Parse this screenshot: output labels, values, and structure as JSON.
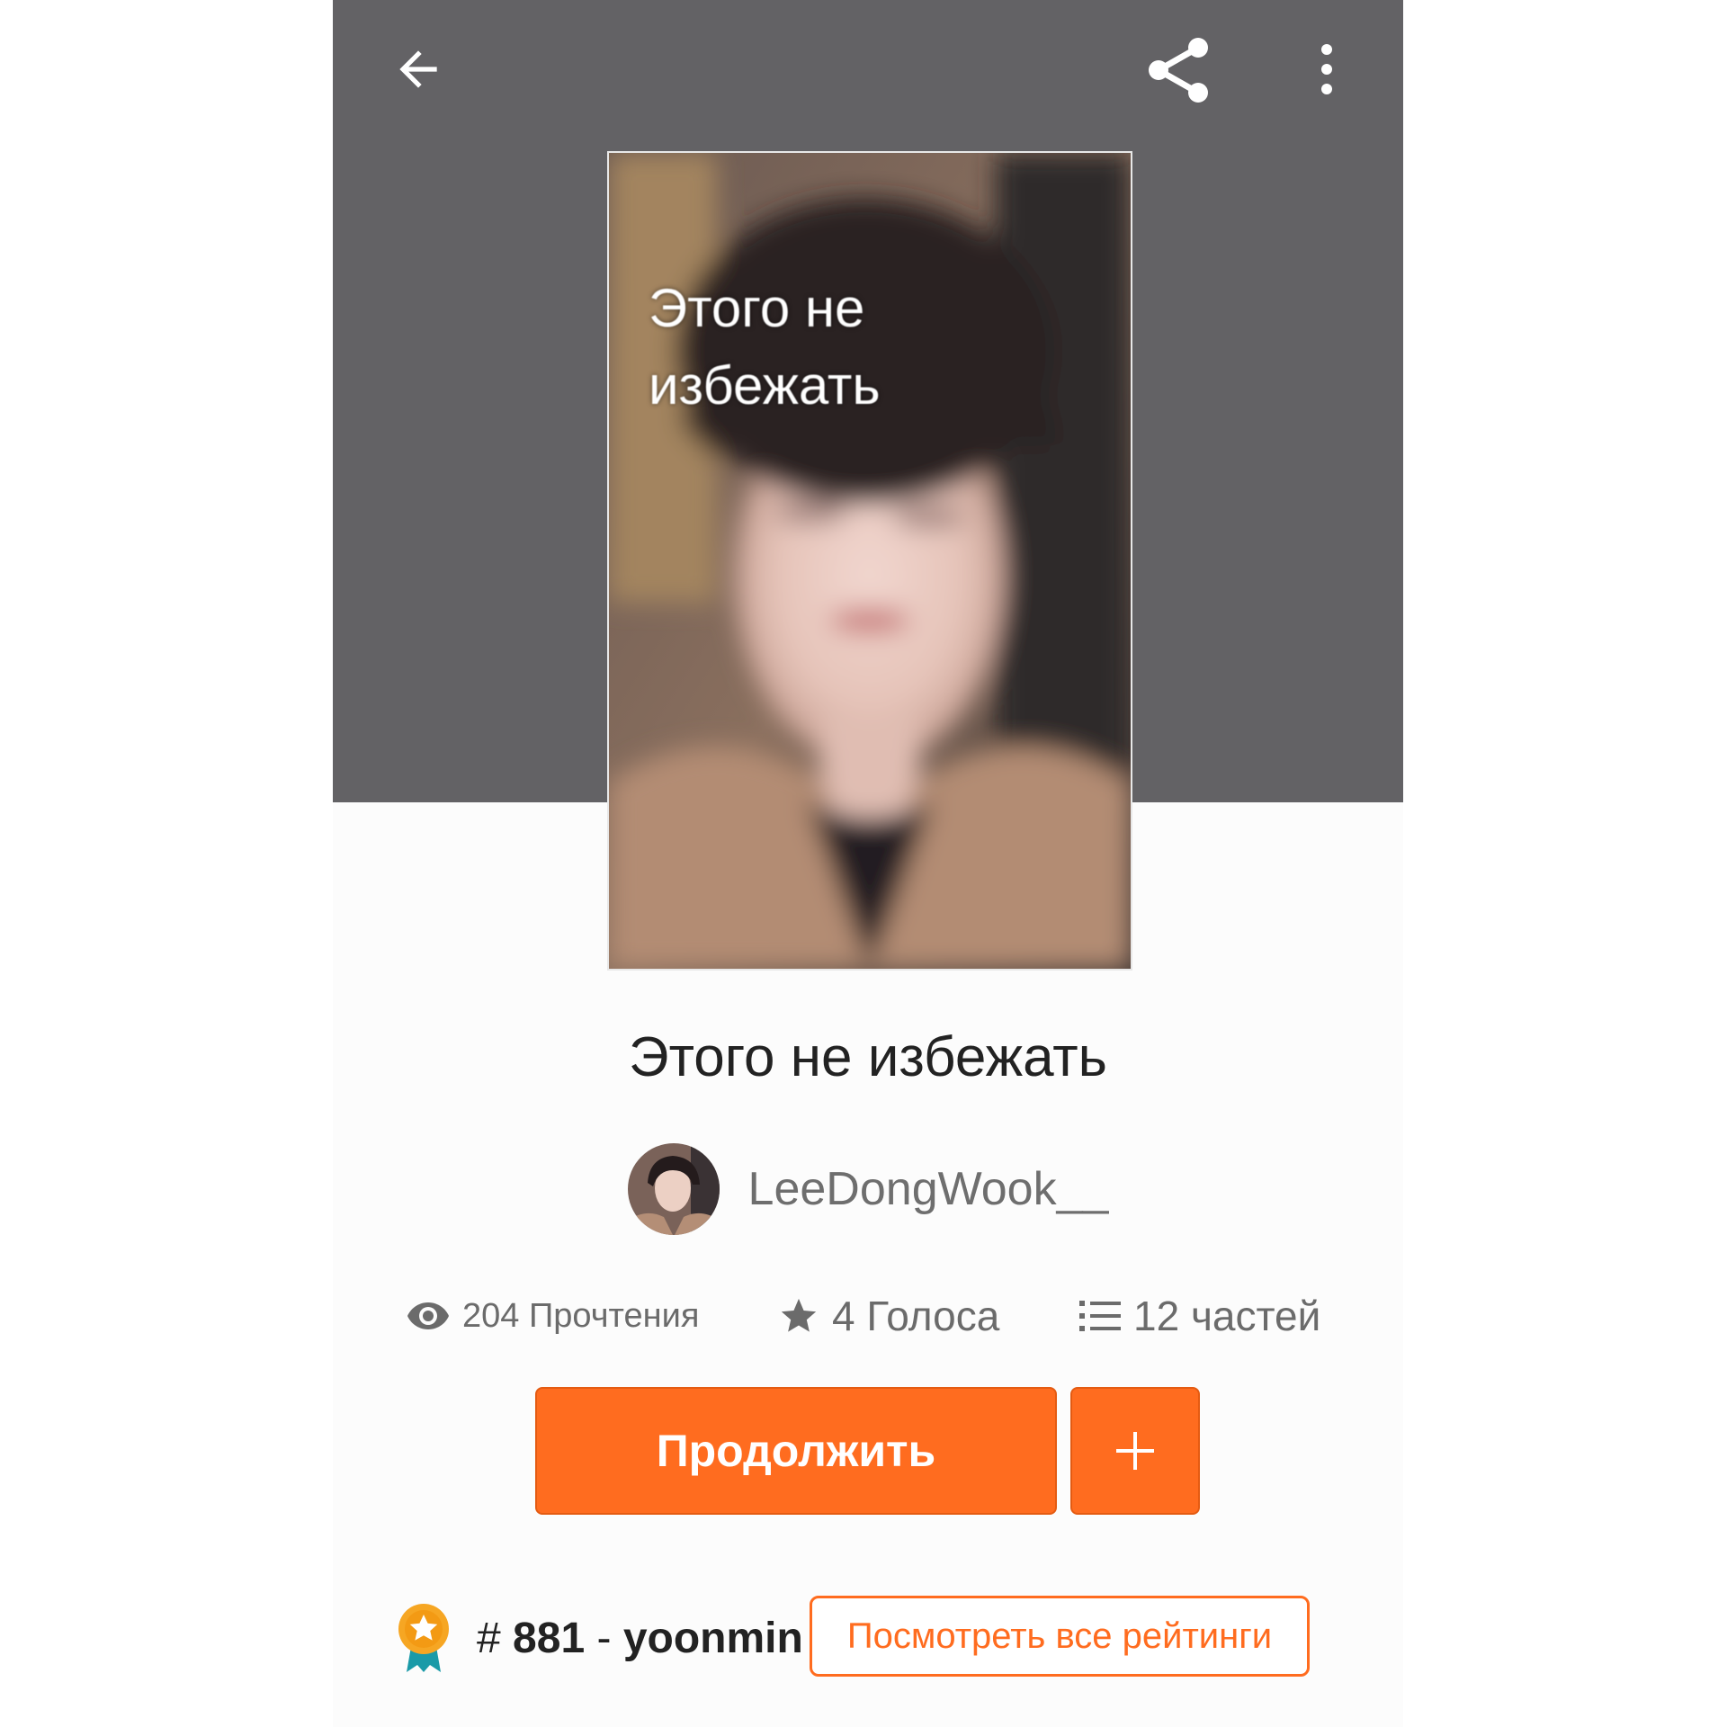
{
  "header": {
    "back_icon": "arrow-left-icon",
    "share_icon": "share-icon",
    "more_icon": "more-vertical-icon"
  },
  "cover": {
    "title_text": "Этого не избежать"
  },
  "story": {
    "title": "Этого не избежать"
  },
  "author": {
    "name": "LeeDongWook__"
  },
  "stats": {
    "reads": "204 Прочтения",
    "votes": "4 Голоса",
    "parts": "12 частей"
  },
  "actions": {
    "continue_label": "Продолжить",
    "add_icon": "plus-icon"
  },
  "ranking": {
    "hash": "#",
    "rank": "881",
    "separator": "-",
    "tag": "yoonmin",
    "view_all_label": "Посмотреть все рейтинги"
  },
  "colors": {
    "accent": "#ff6c1f",
    "header_bg": "#636265",
    "text_primary": "#222222",
    "text_secondary": "#6b6b6b"
  }
}
